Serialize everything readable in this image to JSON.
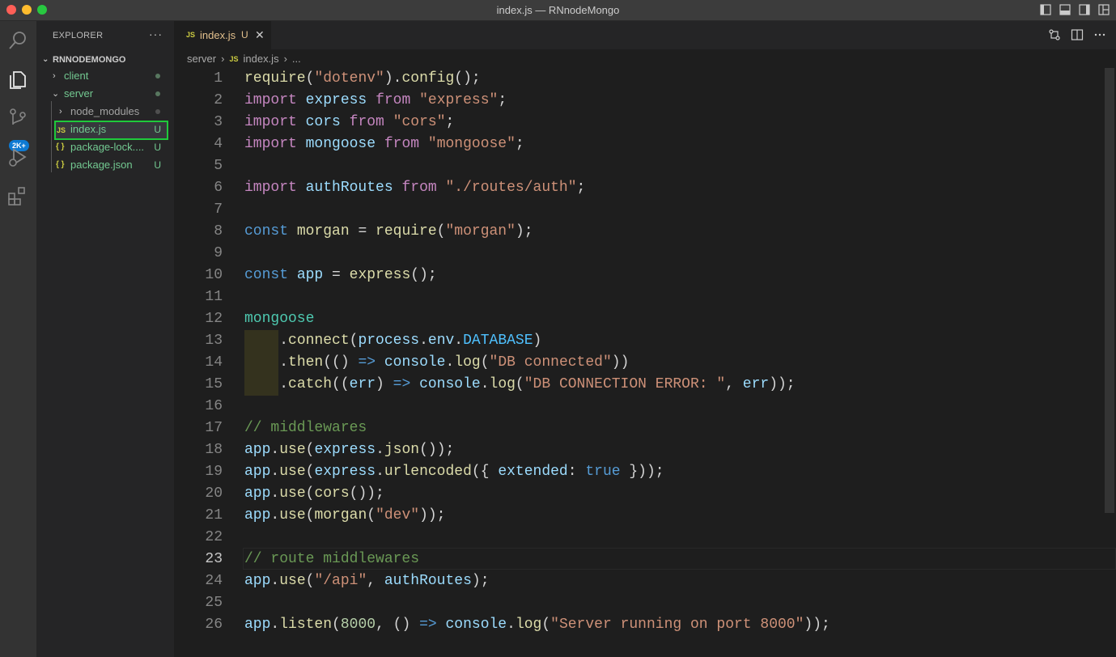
{
  "window": {
    "title": "index.js — RNnodeMongo"
  },
  "activity": {
    "scm_badge": "2K+"
  },
  "sidebar": {
    "header": "EXPLORER",
    "more": "···",
    "root": "RNNODEMONGO",
    "items": [
      {
        "label": "client",
        "status": ""
      },
      {
        "label": "server",
        "status": ""
      },
      {
        "label": "node_modules",
        "status": ""
      },
      {
        "label": "index.js",
        "status": "U"
      },
      {
        "label": "package-lock....",
        "status": "U"
      },
      {
        "label": "package.json",
        "status": "U"
      }
    ],
    "js_icon": "JS",
    "json_icon": "{ }"
  },
  "tab": {
    "icon": "JS",
    "name": "index.js",
    "status": "U",
    "close": "✕"
  },
  "breadcrumb": {
    "folder": "server",
    "sep": "›",
    "icon": "JS",
    "file": "index.js",
    "more": "..."
  },
  "editor": {
    "active_line": 23,
    "lines": [
      [
        [
          "fn",
          "require"
        ],
        [
          "pl",
          "("
        ],
        [
          "st",
          "\"dotenv\""
        ],
        [
          "pl",
          ")."
        ],
        [
          "fn",
          "config"
        ],
        [
          "pl",
          "();"
        ]
      ],
      [
        [
          "kw",
          "import"
        ],
        [
          "pl",
          " "
        ],
        [
          "vr",
          "express"
        ],
        [
          "pl",
          " "
        ],
        [
          "kw",
          "from"
        ],
        [
          "pl",
          " "
        ],
        [
          "st",
          "\"express\""
        ],
        [
          "pl",
          ";"
        ]
      ],
      [
        [
          "kw",
          "import"
        ],
        [
          "pl",
          " "
        ],
        [
          "vr",
          "cors"
        ],
        [
          "pl",
          " "
        ],
        [
          "kw",
          "from"
        ],
        [
          "pl",
          " "
        ],
        [
          "st",
          "\"cors\""
        ],
        [
          "pl",
          ";"
        ]
      ],
      [
        [
          "kw",
          "import"
        ],
        [
          "pl",
          " "
        ],
        [
          "vr",
          "mongoose"
        ],
        [
          "pl",
          " "
        ],
        [
          "kw",
          "from"
        ],
        [
          "pl",
          " "
        ],
        [
          "st",
          "\"mongoose\""
        ],
        [
          "pl",
          ";"
        ]
      ],
      [],
      [
        [
          "kw",
          "import"
        ],
        [
          "pl",
          " "
        ],
        [
          "vr",
          "authRoutes"
        ],
        [
          "pl",
          " "
        ],
        [
          "kw",
          "from"
        ],
        [
          "pl",
          " "
        ],
        [
          "st",
          "\"./routes/auth\""
        ],
        [
          "pl",
          ";"
        ]
      ],
      [],
      [
        [
          "dc",
          "const"
        ],
        [
          "pl",
          " "
        ],
        [
          "fn",
          "morgan"
        ],
        [
          "pl",
          " = "
        ],
        [
          "fn",
          "require"
        ],
        [
          "pl",
          "("
        ],
        [
          "st",
          "\"morgan\""
        ],
        [
          "pl",
          ");"
        ]
      ],
      [],
      [
        [
          "dc",
          "const"
        ],
        [
          "pl",
          " "
        ],
        [
          "vr",
          "app"
        ],
        [
          "pl",
          " = "
        ],
        [
          "fn",
          "express"
        ],
        [
          "pl",
          "();"
        ]
      ],
      [],
      [
        [
          "ns",
          "mongoose"
        ]
      ],
      [
        [
          "pl",
          "    ."
        ],
        [
          "fn",
          "connect"
        ],
        [
          "pl",
          "("
        ],
        [
          "vr",
          "process"
        ],
        [
          "pl",
          "."
        ],
        [
          "vr",
          "env"
        ],
        [
          "pl",
          "."
        ],
        [
          "ct",
          "DATABASE"
        ],
        [
          "pl",
          ")"
        ]
      ],
      [
        [
          "pl",
          "    ."
        ],
        [
          "fn",
          "then"
        ],
        [
          "pl",
          "(() "
        ],
        [
          "dc",
          "=>"
        ],
        [
          "pl",
          " "
        ],
        [
          "vr",
          "console"
        ],
        [
          "pl",
          "."
        ],
        [
          "fn",
          "log"
        ],
        [
          "pl",
          "("
        ],
        [
          "st",
          "\"DB connected\""
        ],
        [
          "pl",
          "))"
        ]
      ],
      [
        [
          "pl",
          "    ."
        ],
        [
          "fn",
          "catch"
        ],
        [
          "pl",
          "(("
        ],
        [
          "vr",
          "err"
        ],
        [
          "pl",
          ") "
        ],
        [
          "dc",
          "=>"
        ],
        [
          "pl",
          " "
        ],
        [
          "vr",
          "console"
        ],
        [
          "pl",
          "."
        ],
        [
          "fn",
          "log"
        ],
        [
          "pl",
          "("
        ],
        [
          "st",
          "\"DB CONNECTION ERROR: \""
        ],
        [
          "pl",
          ", "
        ],
        [
          "vr",
          "err"
        ],
        [
          "pl",
          "));"
        ]
      ],
      [],
      [
        [
          "cm",
          "// middlewares"
        ]
      ],
      [
        [
          "vr",
          "app"
        ],
        [
          "pl",
          "."
        ],
        [
          "fn",
          "use"
        ],
        [
          "pl",
          "("
        ],
        [
          "vr",
          "express"
        ],
        [
          "pl",
          "."
        ],
        [
          "fn",
          "json"
        ],
        [
          "pl",
          "());"
        ]
      ],
      [
        [
          "vr",
          "app"
        ],
        [
          "pl",
          "."
        ],
        [
          "fn",
          "use"
        ],
        [
          "pl",
          "("
        ],
        [
          "vr",
          "express"
        ],
        [
          "pl",
          "."
        ],
        [
          "fn",
          "urlencoded"
        ],
        [
          "pl",
          "({ "
        ],
        [
          "vr",
          "extended"
        ],
        [
          "pl",
          ": "
        ],
        [
          "dc",
          "true"
        ],
        [
          "pl",
          " }));"
        ]
      ],
      [
        [
          "vr",
          "app"
        ],
        [
          "pl",
          "."
        ],
        [
          "fn",
          "use"
        ],
        [
          "pl",
          "("
        ],
        [
          "fn",
          "cors"
        ],
        [
          "pl",
          "());"
        ]
      ],
      [
        [
          "vr",
          "app"
        ],
        [
          "pl",
          "."
        ],
        [
          "fn",
          "use"
        ],
        [
          "pl",
          "("
        ],
        [
          "fn",
          "morgan"
        ],
        [
          "pl",
          "("
        ],
        [
          "st",
          "\"dev\""
        ],
        [
          "pl",
          "));"
        ]
      ],
      [],
      [
        [
          "cm",
          "// route middlewares"
        ]
      ],
      [
        [
          "vr",
          "app"
        ],
        [
          "pl",
          "."
        ],
        [
          "fn",
          "use"
        ],
        [
          "pl",
          "("
        ],
        [
          "st",
          "\"/api\""
        ],
        [
          "pl",
          ", "
        ],
        [
          "vr",
          "authRoutes"
        ],
        [
          "pl",
          ");"
        ]
      ],
      [],
      [
        [
          "vr",
          "app"
        ],
        [
          "pl",
          "."
        ],
        [
          "fn",
          "listen"
        ],
        [
          "pl",
          "("
        ],
        [
          "nm",
          "8000"
        ],
        [
          "pl",
          ", () "
        ],
        [
          "dc",
          "=>"
        ],
        [
          "pl",
          " "
        ],
        [
          "vr",
          "console"
        ],
        [
          "pl",
          "."
        ],
        [
          "fn",
          "log"
        ],
        [
          "pl",
          "("
        ],
        [
          "st",
          "\"Server running on port 8000\""
        ],
        [
          "pl",
          "));"
        ]
      ]
    ]
  }
}
